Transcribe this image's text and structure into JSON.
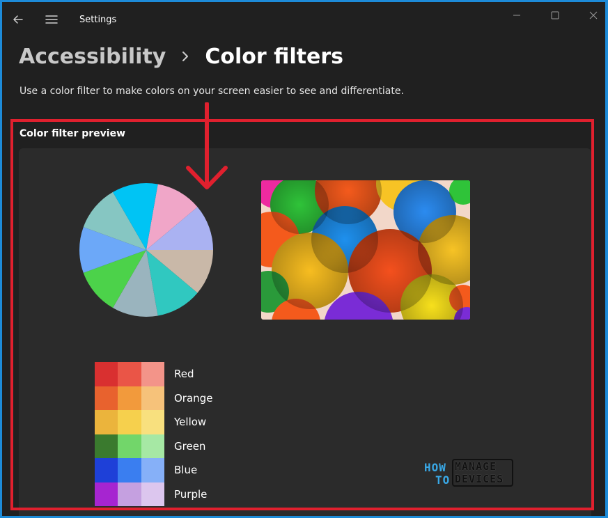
{
  "titlebar": {
    "app_title": "Settings",
    "icons": [
      "back-icon",
      "hamburger-menu-icon",
      "minimize-icon",
      "maximize-icon",
      "close-icon"
    ]
  },
  "breadcrumb": {
    "parent": "Accessibility",
    "current": "Color filters"
  },
  "description": "Use a color filter to make colors on your screen easier to see and differentiate.",
  "preview": {
    "label": "Color filter preview",
    "pie_colors": [
      "#f0a6c8",
      "#aab2f2",
      "#c9b8a8",
      "#30c8c0",
      "#9ab4be",
      "#4cd24a",
      "#6ca8f8",
      "#86c6c2",
      "#00c4f4"
    ],
    "swatches": [
      {
        "label": "Red",
        "colors": [
          "#d93030",
          "#ea5547",
          "#f39489"
        ]
      },
      {
        "label": "Orange",
        "colors": [
          "#e8622e",
          "#f29a3c",
          "#f6c27a"
        ]
      },
      {
        "label": "Yellow",
        "colors": [
          "#ebb43c",
          "#f6d04d",
          "#f8e07e"
        ]
      },
      {
        "label": "Green",
        "colors": [
          "#3a7a2e",
          "#72d66a",
          "#a6e8a4"
        ]
      },
      {
        "label": "Blue",
        "colors": [
          "#1e40d8",
          "#3a7ef0",
          "#86b0f8"
        ]
      },
      {
        "label": "Purple",
        "colors": [
          "#a625d0",
          "#c5a0e0",
          "#dcc6ee"
        ]
      }
    ]
  },
  "watermark": {
    "how": "HOW",
    "to": "TO",
    "manage": "MANAGE",
    "devices": "DEVICES"
  },
  "colors": {
    "annotation_red": "#e0202e",
    "frame_blue": "#1d8bd8",
    "window_bg": "#202020",
    "card_bg": "#2b2b2b"
  }
}
